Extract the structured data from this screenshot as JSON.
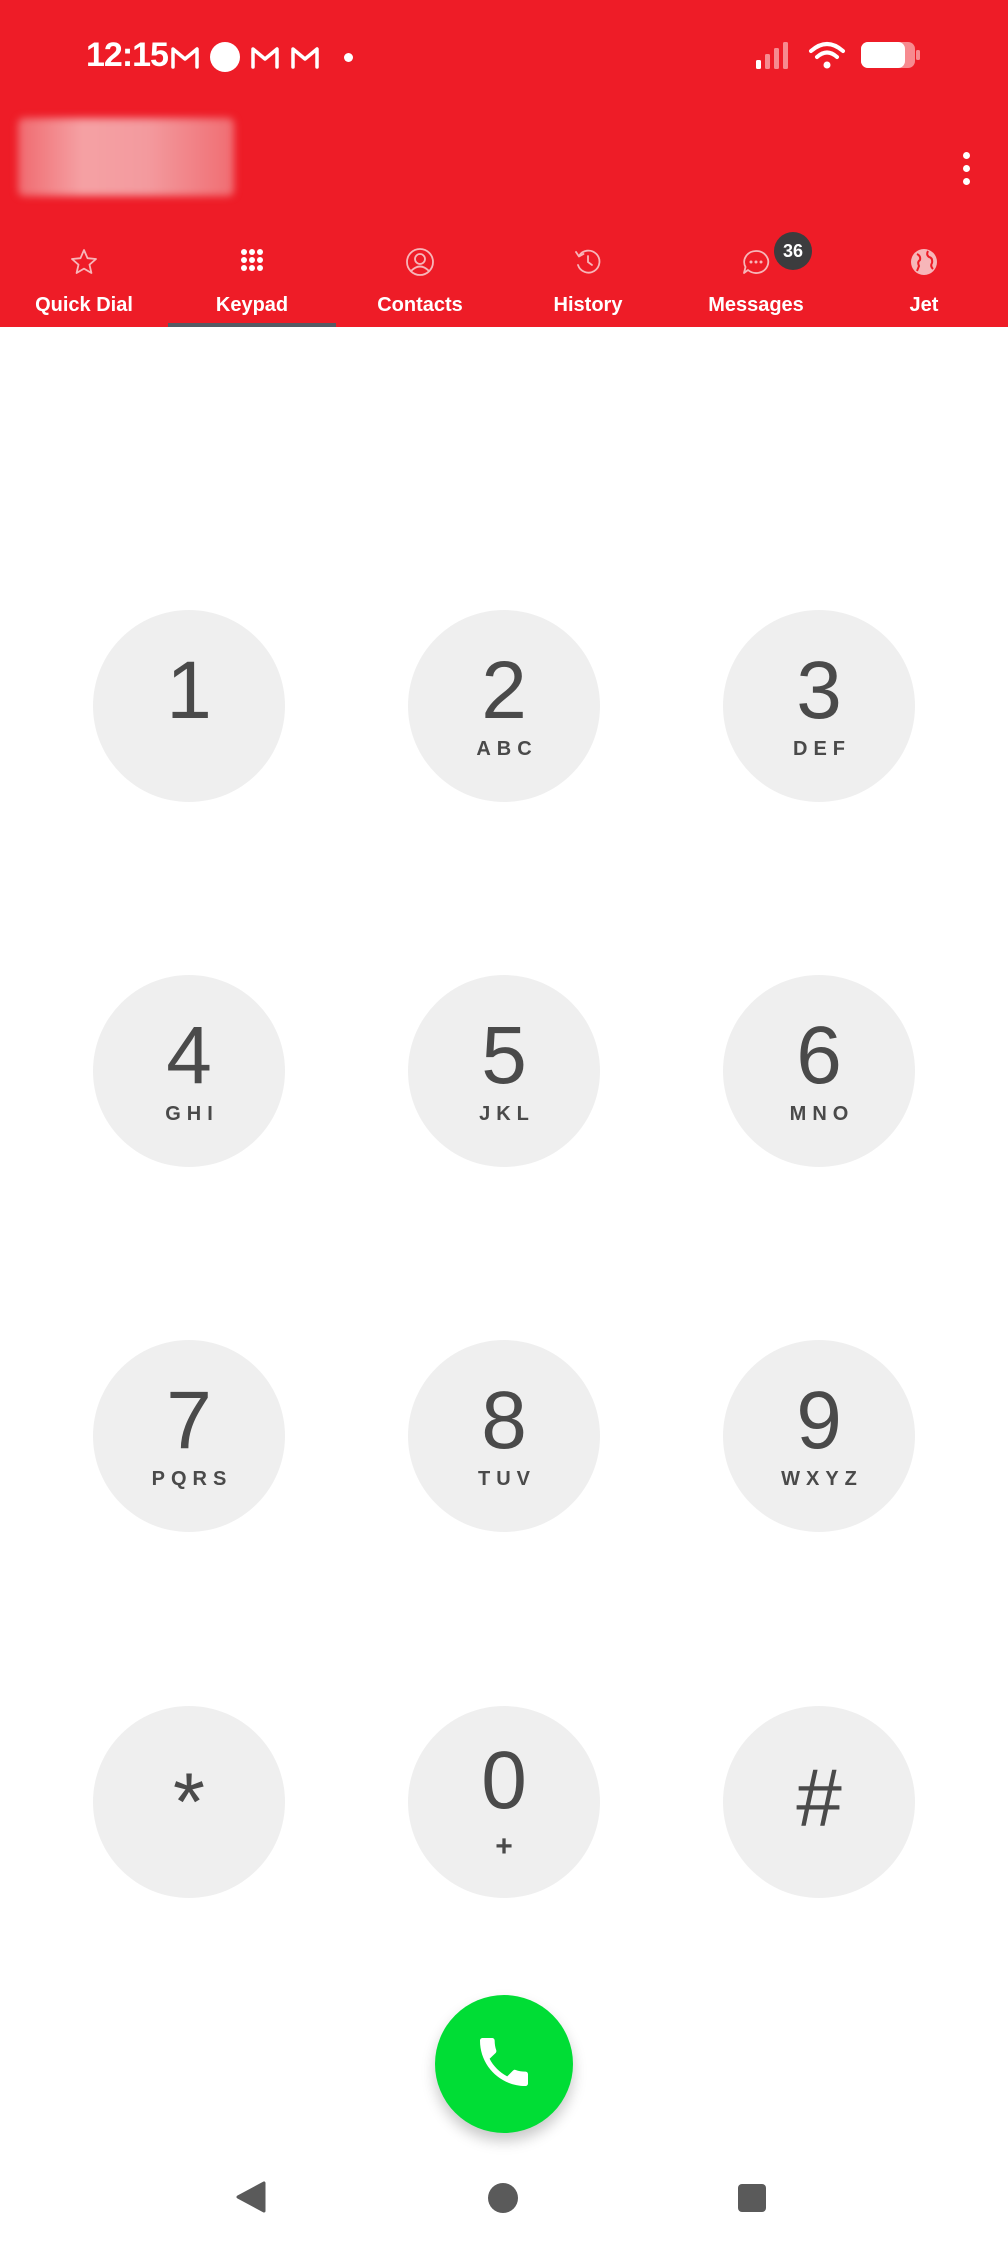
{
  "status_bar": {
    "time": "12:15",
    "notification_icons": [
      "gmail-icon",
      "circle-notification-icon",
      "gmail-icon",
      "gmail-icon",
      "more-notifications-dot-icon"
    ],
    "system_icons": [
      "cellular-signal-icon",
      "wifi-icon",
      "battery-icon"
    ]
  },
  "colors": {
    "header_bg": "#ee1c27",
    "key_bg": "#efefef",
    "call_button": "#00dd35",
    "tab_indicator": "#555a63"
  },
  "header": {
    "menu_icon": "more-vertical-icon"
  },
  "tabs": [
    {
      "label": "Quick Dial",
      "icon": "star-icon",
      "active": false
    },
    {
      "label": "Keypad",
      "icon": "dialpad-icon",
      "active": true
    },
    {
      "label": "Contacts",
      "icon": "person-circle-icon",
      "active": false
    },
    {
      "label": "History",
      "icon": "history-icon",
      "active": false
    },
    {
      "label": "Messages",
      "icon": "chat-bubble-icon",
      "active": false,
      "badge": "36"
    },
    {
      "label": "Jet",
      "icon": "globe-icon",
      "active": false
    }
  ],
  "keypad": {
    "keys": [
      {
        "digit": "1",
        "letters": ""
      },
      {
        "digit": "2",
        "letters": "ABC"
      },
      {
        "digit": "3",
        "letters": "DEF"
      },
      {
        "digit": "4",
        "letters": "GHI"
      },
      {
        "digit": "5",
        "letters": "JKL"
      },
      {
        "digit": "6",
        "letters": "MNO"
      },
      {
        "digit": "7",
        "letters": "PQRS"
      },
      {
        "digit": "8",
        "letters": "TUV"
      },
      {
        "digit": "9",
        "letters": "WXYZ"
      },
      {
        "digit": "*",
        "letters": ""
      },
      {
        "digit": "0",
        "letters": "+"
      },
      {
        "digit": "#",
        "letters": ""
      }
    ]
  },
  "call_button_icon": "phone-icon",
  "nav_bar": [
    "back-icon",
    "home-icon",
    "recents-icon"
  ]
}
